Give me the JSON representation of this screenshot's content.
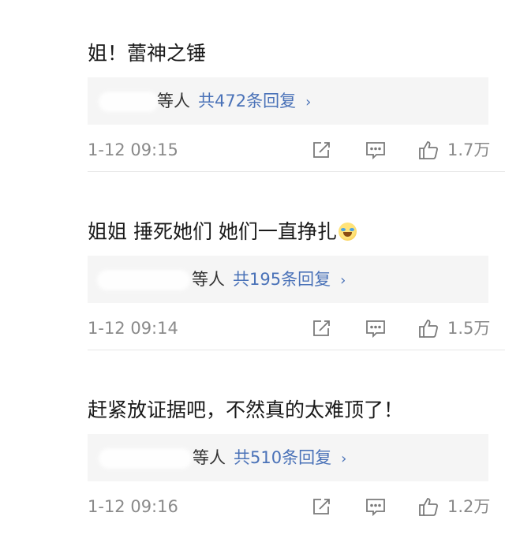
{
  "comments": [
    {
      "text": "姐！蕾神之锤",
      "reply_who": "等人",
      "reply_count": "共472条回复",
      "reply_arrow": "›",
      "time": "1-12 09:15",
      "likes": "1.7万"
    },
    {
      "text": "姐姐 捶死她们 她们一直挣扎",
      "reply_who": "等人",
      "reply_count": "共195条回复",
      "reply_arrow": "›",
      "time": "1-12 09:14",
      "likes": "1.5万"
    },
    {
      "text": "赶紧放证据吧，不然真的太难顶了！",
      "reply_who": "等人",
      "reply_count": "共510条回复",
      "reply_arrow": "›",
      "time": "1-12 09:16",
      "likes": "1.2万"
    }
  ],
  "icons": {
    "repost": "repost-icon",
    "comment": "comment-icon",
    "like": "thumbs-up-icon",
    "emoji": "laughing-tears-emoji"
  },
  "colors": {
    "link": "#4a72b8",
    "meta": "#8a8a8a",
    "reply_bg": "#f5f5f5"
  }
}
